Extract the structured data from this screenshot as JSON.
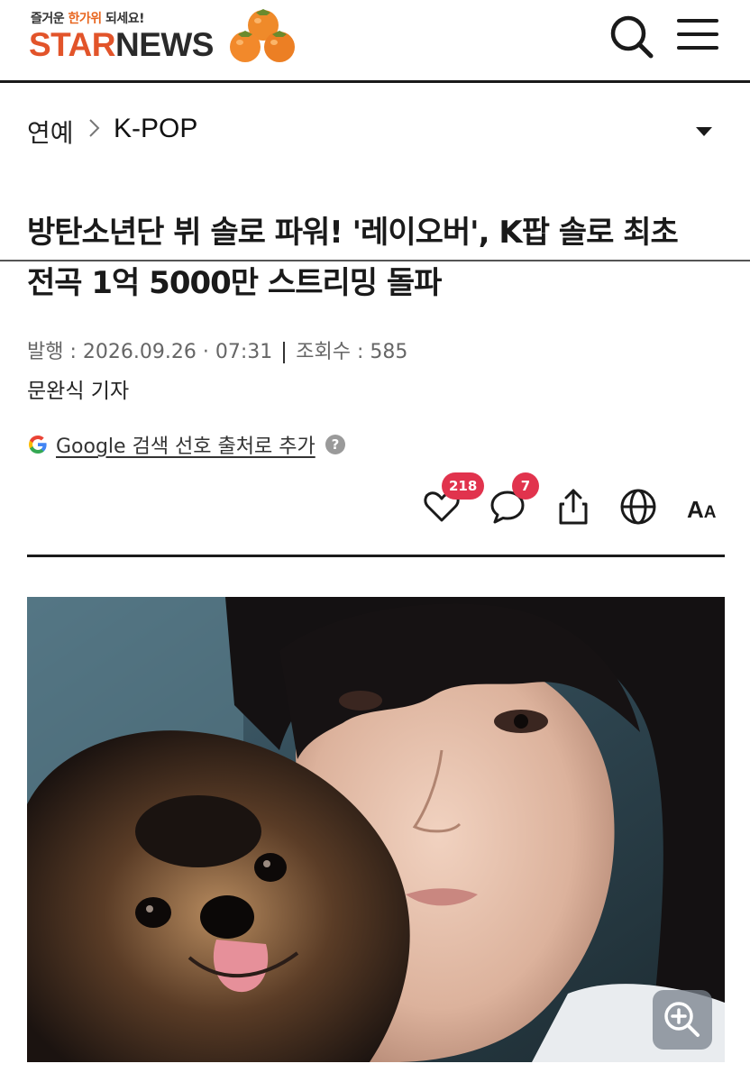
{
  "header": {
    "tagline_pre": "즐거운 ",
    "tagline_highlight": "한가위",
    "tagline_post": " 되세요!",
    "logo_star": "STAR",
    "logo_news": "NEWS",
    "search_icon": "search-icon",
    "menu_icon": "hamburger-menu-icon",
    "accent_color": "#e2542a"
  },
  "breadcrumb": {
    "section": "연예",
    "subsection": "K-POP"
  },
  "article": {
    "title_line1": "방탄소년단 뷔 솔로 파워! '레이오버', K팝 솔로 최초",
    "title_line2": "전곡 1억 5000만 스트리밍 돌파",
    "published_label": "발행 : 2026.09.26 · 07:31",
    "views_label": "조회수 : 585",
    "reporter": "문완식 기자",
    "google_pref": "Google 검색 선호 출처로 추가"
  },
  "actions": {
    "likes": "218",
    "comments": "7",
    "aa_big": "A",
    "aa_small": "A",
    "badge_color": "#e1334d"
  },
  "photo": {
    "zoom_icon": "zoom-in-icon"
  }
}
